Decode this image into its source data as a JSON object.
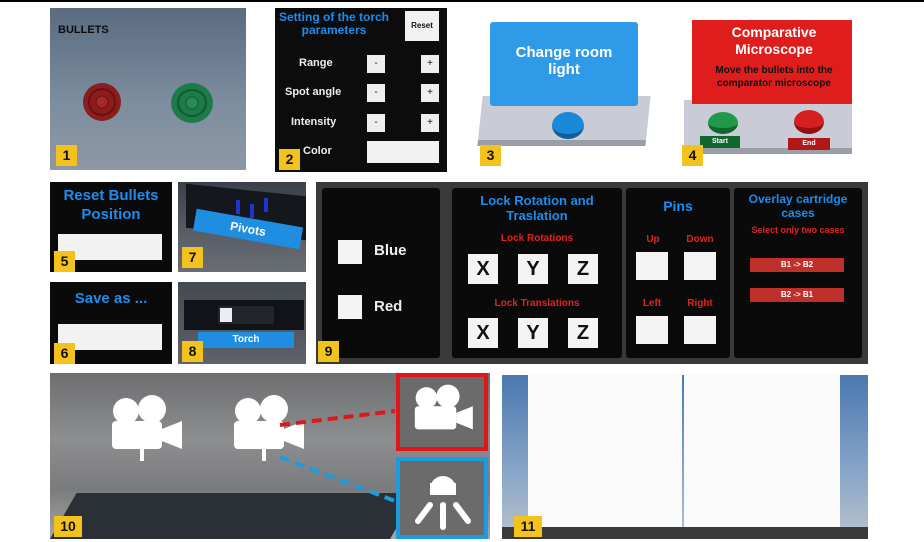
{
  "panel1": {
    "title": "BULLETS",
    "number": "1"
  },
  "panel2": {
    "title": "Setting of the torch parameters",
    "reset": "Reset",
    "rows": [
      {
        "label": "Range",
        "minus": "-",
        "plus": "+"
      },
      {
        "label": "Spot angle",
        "minus": "-",
        "plus": "+"
      },
      {
        "label": "Intensity",
        "minus": "-",
        "plus": "+"
      }
    ],
    "color_label": "Color",
    "number": "2"
  },
  "panel3": {
    "title": "Change room light",
    "number": "3"
  },
  "panel4": {
    "title": "Comparative Microscope",
    "subtitle": "Move the bullets into the comparator microscope",
    "start": "Start",
    "end": "End",
    "number": "4"
  },
  "panel5": {
    "title": "Reset Bullets Position",
    "number": "5"
  },
  "panel6": {
    "title": "Save as ...",
    "number": "6"
  },
  "panel7": {
    "label": "Pivots",
    "number": "7"
  },
  "panel8": {
    "label": "Torch",
    "number": "8"
  },
  "panel9": {
    "colors": [
      "Blue",
      "Red"
    ],
    "lock_title": "Lock Rotation and Traslation",
    "lock_rotations": "Lock Rotations",
    "lock_translations": "Lock Translations",
    "axes": [
      "X",
      "Y",
      "Z"
    ],
    "pins_title": "Pins",
    "pins": [
      "Up",
      "Down",
      "Left",
      "Right"
    ],
    "overlay_title": "Overlay cartridge cases",
    "overlay_subtitle": "Select only two cases",
    "overlay_buttons": [
      "B1 -> B2",
      "B2 -> B1"
    ],
    "number": "9"
  },
  "panel10": {
    "number": "10",
    "icons": [
      "camera-icon",
      "camera-icon",
      "camera-icon",
      "spotlight-icon"
    ]
  },
  "panel11": {
    "number": "11"
  },
  "colors": {
    "accent_blue": "#1b8df0",
    "accent_red": "#e02323",
    "badge": "#f4c21c"
  }
}
